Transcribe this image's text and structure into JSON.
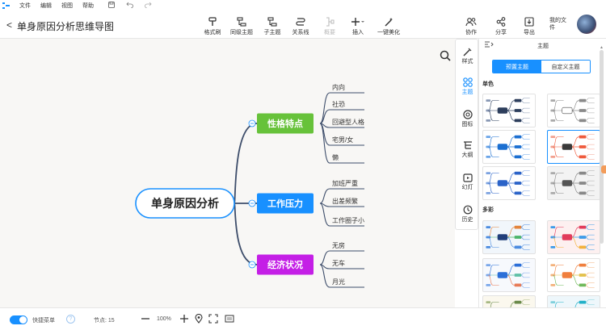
{
  "menubar": {
    "items": [
      "文件",
      "编辑",
      "视图",
      "帮助"
    ]
  },
  "header": {
    "back": "<",
    "title": "单身原因分析思维导图",
    "tools": [
      {
        "label": "格式刷",
        "icon": "format-brush-icon"
      },
      {
        "label": "同级主题",
        "icon": "sibling-topic-icon"
      },
      {
        "label": "子主题",
        "icon": "subtopic-icon"
      },
      {
        "label": "关系线",
        "icon": "relation-line-icon"
      },
      {
        "label": "概要",
        "icon": "summary-icon"
      },
      {
        "label": "插入",
        "icon": "insert-icon"
      },
      {
        "label": "一键美化",
        "icon": "magic-wand-icon"
      }
    ],
    "right_tools": [
      {
        "label": "协作",
        "icon": "collaborate-icon"
      },
      {
        "label": "分享",
        "icon": "share-icon"
      },
      {
        "label": "导出",
        "icon": "export-icon"
      }
    ],
    "my_files": "我的文件"
  },
  "mindmap": {
    "root": "单身原因分析",
    "branches": [
      {
        "label": "性格特点",
        "color": "#67c23a",
        "children": [
          "内向",
          "社恐",
          "回避型人格",
          "宅男/女",
          "懒"
        ]
      },
      {
        "label": "工作压力",
        "color": "#1890ff",
        "children": [
          "加班严重",
          "出差频繁",
          "工作圈子小"
        ]
      },
      {
        "label": "经济状况",
        "color": "#c41fe6",
        "children": [
          "无房",
          "无车",
          "月光"
        ]
      }
    ]
  },
  "side_tabs": [
    {
      "label": "样式",
      "icon": "style-icon"
    },
    {
      "label": "主题",
      "icon": "theme-icon"
    },
    {
      "label": "图标",
      "icon": "icon-library-icon"
    },
    {
      "label": "大纲",
      "icon": "outline-icon"
    },
    {
      "label": "幻灯",
      "icon": "slides-icon"
    },
    {
      "label": "历史",
      "icon": "history-icon"
    }
  ],
  "theme_panel": {
    "title": "主题",
    "tab_preset": "预置主题",
    "tab_custom": "自定义主题",
    "section_mono": "单色",
    "section_color": "多彩"
  },
  "statusbar": {
    "quick_menu": "快捷菜单",
    "help": "?",
    "nodes_label": "节点: 15",
    "zoom": "100%"
  },
  "colors": {
    "accent": "#1890ff",
    "green": "#67c23a",
    "blue": "#1890ff",
    "purple": "#c41fe6",
    "line": "#3d4d6a"
  }
}
